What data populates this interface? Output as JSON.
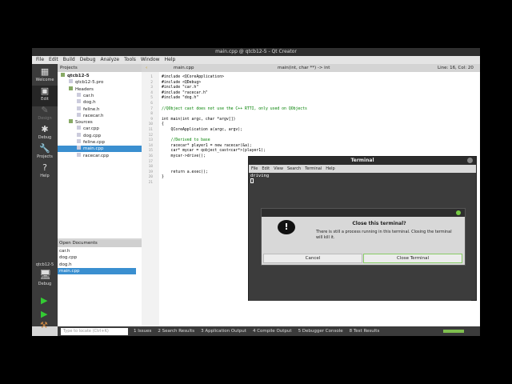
{
  "window": {
    "title": "main.cpp @ qtcb12-5 - Qt Creator"
  },
  "menu": [
    "File",
    "Edit",
    "Build",
    "Debug",
    "Analyze",
    "Tools",
    "Window",
    "Help"
  ],
  "modes": [
    {
      "label": "Welcome",
      "icon": "grid-icon"
    },
    {
      "label": "Edit",
      "icon": "edit-icon"
    },
    {
      "label": "Design",
      "icon": "pen-icon"
    },
    {
      "label": "Debug",
      "icon": "bug-icon"
    },
    {
      "label": "Projects",
      "icon": "wrench-icon"
    },
    {
      "label": "Help",
      "icon": "help-icon"
    }
  ],
  "kit": {
    "project": "qtcb12-5",
    "config": "Debug"
  },
  "projects": {
    "header": "Projects",
    "tree": [
      {
        "label": "qtcb12-5",
        "level": 0,
        "bold": true
      },
      {
        "label": "qtcb12-5.pro",
        "level": 1
      },
      {
        "label": "Headers",
        "level": 1
      },
      {
        "label": "car.h",
        "level": 2
      },
      {
        "label": "dog.h",
        "level": 2
      },
      {
        "label": "feline.h",
        "level": 2
      },
      {
        "label": "racecar.h",
        "level": 2
      },
      {
        "label": "Sources",
        "level": 1
      },
      {
        "label": "car.cpp",
        "level": 2
      },
      {
        "label": "dog.cpp",
        "level": 2
      },
      {
        "label": "feline.cpp",
        "level": 2
      },
      {
        "label": "main.cpp",
        "level": 2,
        "selected": true
      },
      {
        "label": "racecar.cpp",
        "level": 2
      }
    ]
  },
  "open_documents": {
    "header": "Open Documents",
    "items": [
      {
        "label": "car.h"
      },
      {
        "label": "dog.cpp"
      },
      {
        "label": "dog.h"
      },
      {
        "label": "main.cpp",
        "selected": true
      }
    ]
  },
  "editor": {
    "file": "main.cpp",
    "symbol": "main(int, char **) -> int",
    "position": "Line: 16, Col: 20",
    "lines": [
      "#include <QCoreApplication>",
      "#include <QDebug>",
      "#include \"car.h\"",
      "#include \"racecar.h\"",
      "#include \"dog.h\"",
      "",
      "//QObject cast does not use the C++ RTTI, only used on QObjects",
      "",
      "int main(int argc, char *argv[])",
      "{",
      "    QCoreApplication a(argc, argv);",
      "",
      "    //Derived to base",
      "    racecar* player1 = new racecar(&a);",
      "    car* mycar = qobject_cast<car*>(player1);",
      "    mycar->drive();",
      "",
      "",
      "    return a.exec();",
      "}",
      ""
    ]
  },
  "bottom": {
    "locate_placeholder": "Type to locate (Ctrl+K)",
    "tabs": [
      "1 Issues",
      "2 Search Results",
      "3 Application Output",
      "4 Compile Output",
      "5 Debugger Console",
      "8 Test Results"
    ]
  },
  "terminal": {
    "title": "Terminal",
    "menu": [
      "File",
      "Edit",
      "View",
      "Search",
      "Terminal",
      "Help"
    ],
    "output": "driving"
  },
  "dialog": {
    "title": "Close this terminal?",
    "message": "There is still a process running in this terminal. Closing the terminal will kill it.",
    "cancel": "Cancel",
    "confirm": "Close Terminal"
  }
}
